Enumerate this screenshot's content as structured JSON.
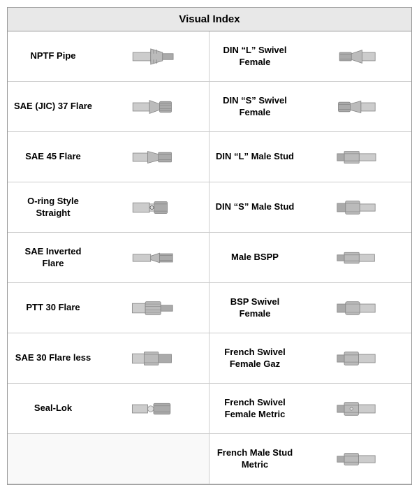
{
  "title": "Visual Index",
  "rows": [
    {
      "left_label": "NPTF Pipe",
      "right_label": "DIN “L” Swivel Female"
    },
    {
      "left_label": "SAE (JIC) 37 Flare",
      "right_label": "DIN “S” Swivel Female"
    },
    {
      "left_label": "SAE 45 Flare",
      "right_label": "DIN “L” Male Stud"
    },
    {
      "left_label": "O-ring Style Straight",
      "right_label": "DIN “S” Male Stud"
    },
    {
      "left_label": "SAE Inverted Flare",
      "right_label": "Male BSPP"
    },
    {
      "left_label": "PTT 30 Flare",
      "right_label": "BSP Swivel Female"
    },
    {
      "left_label": "SAE 30 Flare less",
      "right_label": "French Swivel Female Gaz"
    },
    {
      "left_label": "Seal-Lok",
      "right_label": "French Swivel Female Metric"
    },
    {
      "left_label": "",
      "right_label": "French Male Stud Metric"
    }
  ],
  "colors": {
    "header_bg": "#e8e8e8",
    "border": "#999999",
    "cell_border": "#cccccc"
  }
}
